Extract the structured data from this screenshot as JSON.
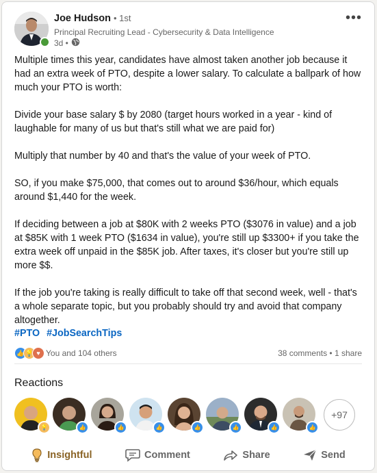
{
  "post": {
    "author": {
      "name": "Joe Hudson",
      "degree": "• 1st",
      "headline": "Principal Recruiting Lead - Cybersecurity & Data Intelligence",
      "time": "3d •"
    },
    "paragraphs": [
      "Multiple times this year, candidates have almost taken another job because it had an extra week of PTO, despite a lower salary. To calculate a ballpark of how much your PTO is worth:",
      "Divide your base salary $ by 2080 (target hours worked in a year - kind of laughable for many of us but that's still what we are paid for)",
      "Multiply that number by 40 and that's the value of your week of PTO.",
      "SO, if you make $75,000, that comes out to around $36/hour, which equals around $1,440 for the week.",
      "If deciding between a job at $80K with 2 weeks PTO ($3076 in value) and a job at $85K with 1 week PTO ($1634 in value), you're still up $3300+ if you take the extra week off unpaid in the $85K job. After taxes, it's closer but you're still up more $$.",
      "If the job you're taking is really difficult to take off that second week, well - that's a whole separate topic, but you probably should try and avoid that company altogether."
    ],
    "hashtags": [
      "#PTO",
      "#JobSearchTips"
    ]
  },
  "social": {
    "reaction_summary": "You and 104 others",
    "comments_shares": "38 comments • 1 share"
  },
  "reactions": {
    "title": "Reactions",
    "more_count": "+97"
  },
  "actions": {
    "insightful": "Insightful",
    "comment": "Comment",
    "share": "Share",
    "send": "Send"
  },
  "colors": {
    "link": "#0a66c2",
    "insightful": "#8a6325",
    "like": "#378fe9"
  }
}
